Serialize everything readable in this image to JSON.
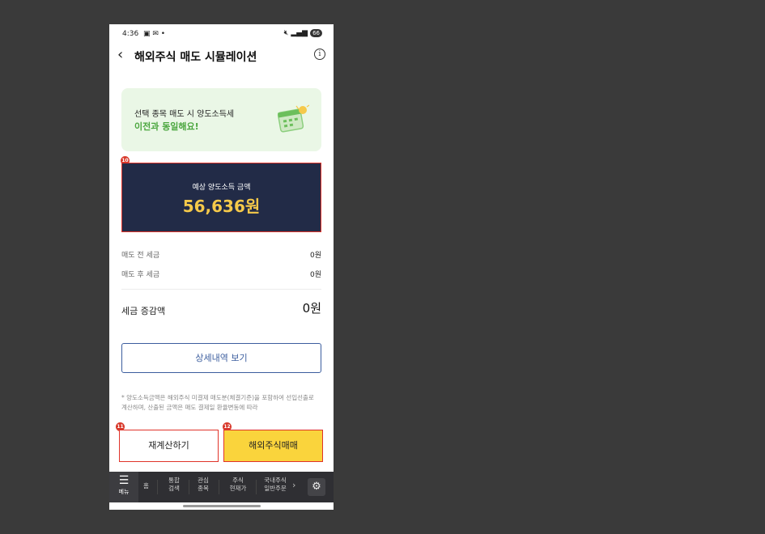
{
  "status_bar": {
    "time": "4:36",
    "left_icons": "▣ ✉ •",
    "battery": "66"
  },
  "header": {
    "title": "해외주식 매도 시뮬레이션",
    "back_glyph": "‹",
    "info_glyph": "i"
  },
  "banner": {
    "line1": "선택 종목 매도 시 양도소득세",
    "line2": "이전과 동일해요!"
  },
  "markers": {
    "m10": "10",
    "m11": "11",
    "m12": "12"
  },
  "summary": {
    "label": "예상 양도소득 금액",
    "amount": "56,636원"
  },
  "tax_rows": [
    {
      "label": "매도 전 세금",
      "value": "0원"
    },
    {
      "label": "매도 후 세금",
      "value": "0원"
    }
  ],
  "total": {
    "label": "세금 증감액",
    "value": "0원"
  },
  "detail_button": "상세내역 보기",
  "note": "* 양도소득금액은 해외주식 미결제 매도분(체결기준)을 포함하여 선입선출로 계산하며, 산출된 금액은 매도 결제일 환율변동에 따라",
  "actions": {
    "recalc": "재계산하기",
    "trade": "해외주식매매"
  },
  "bottom_nav": {
    "menu": "메뉴",
    "items": [
      {
        "l1": "홈",
        "l2": ""
      },
      {
        "l1": "통합",
        "l2": "검색"
      },
      {
        "l1": "관심",
        "l2": "종목"
      },
      {
        "l1": "주식",
        "l2": "현재가"
      },
      {
        "l1": "국내주식",
        "l2": "일반주문"
      }
    ]
  },
  "colors": {
    "accent_green": "#4aa63e",
    "amount_yellow": "#f5c94a",
    "marker_red": "#d8392b",
    "trade_yellow": "#fad43c",
    "dark_navy": "#222b47"
  }
}
